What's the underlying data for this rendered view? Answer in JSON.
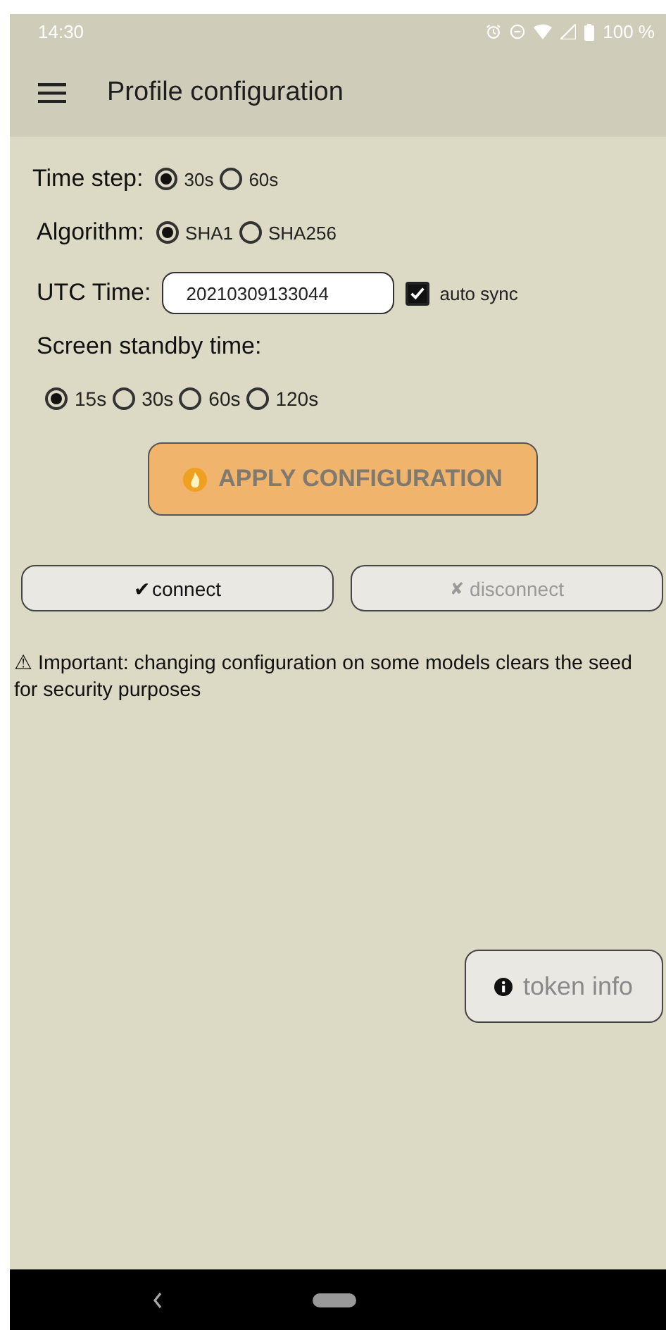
{
  "status_bar": {
    "time": "14:30",
    "battery": "100 %"
  },
  "app_bar": {
    "title": "Profile configuration"
  },
  "time_step": {
    "label": "Time step:",
    "options": [
      {
        "label": "30s",
        "selected": true
      },
      {
        "label": "60s",
        "selected": false
      }
    ]
  },
  "algorithm": {
    "label": "Algorithm:",
    "options": [
      {
        "label": "SHA1",
        "selected": true
      },
      {
        "label": "SHA256",
        "selected": false
      }
    ]
  },
  "utc_time": {
    "label": "UTC Time:",
    "value": "20210309133044",
    "auto_sync": {
      "label": "auto sync",
      "checked": true
    }
  },
  "standby": {
    "label": "Screen standby time:",
    "options": [
      {
        "label": "15s",
        "selected": true
      },
      {
        "label": "30s",
        "selected": false
      },
      {
        "label": "60s",
        "selected": false
      },
      {
        "label": "120s",
        "selected": false
      }
    ]
  },
  "apply_button": {
    "label": "APPLY CONFIGURATION"
  },
  "connection_buttons": [
    {
      "mark": "✔",
      "label": "connect",
      "disabled": false
    },
    {
      "mark": "✘",
      "label": "disconnect",
      "disabled": true
    }
  ],
  "warning": "⚠ Important: changing configuration on some models clears the seed for security purposes",
  "token_info_button": {
    "label": "token info"
  }
}
